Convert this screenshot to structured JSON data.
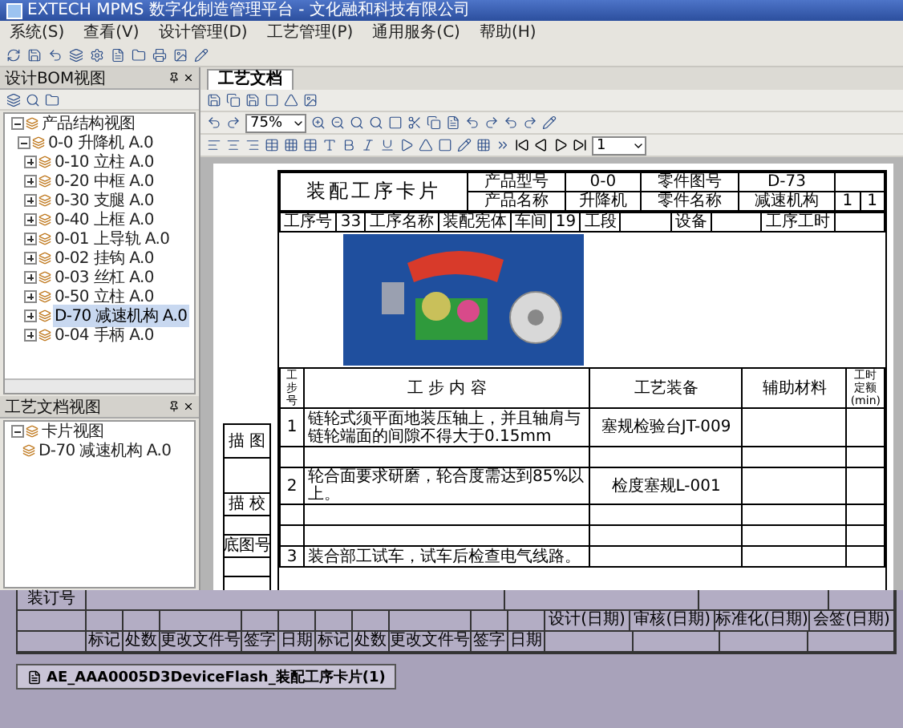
{
  "window": {
    "title": "EXTECH MPMS 数字化制造管理平台 - 文化融和科技有限公司"
  },
  "menu": [
    "系统(S)",
    "查看(V)",
    "设计管理(D)",
    "工艺管理(P)",
    "通用服务(C)",
    "帮助(H)"
  ],
  "bom_panel": {
    "title": "设计BOM视图",
    "tree": [
      {
        "label": "产品结构视图",
        "expanded": true,
        "selected": false,
        "children": [
          {
            "label": "0-0 升降机 A.0",
            "expanded": true,
            "selected": false,
            "children": [
              {
                "label": "0-10 立柱 A.0",
                "expanded": false,
                "selected": false
              },
              {
                "label": "0-20 中框 A.0",
                "expanded": false,
                "selected": false
              },
              {
                "label": "0-30 支腿 A.0",
                "expanded": false,
                "selected": false
              },
              {
                "label": "0-40 上框 A.0",
                "expanded": false,
                "selected": false
              },
              {
                "label": "0-01 上导轨 A.0",
                "expanded": false,
                "selected": false
              },
              {
                "label": "0-02 挂钩 A.0",
                "expanded": false,
                "selected": false
              },
              {
                "label": "0-03 丝杠 A.0",
                "expanded": false,
                "selected": false
              },
              {
                "label": "0-50 立柱 A.0",
                "expanded": false,
                "selected": false
              },
              {
                "label": "D-70 减速机构 A.0",
                "expanded": false,
                "selected": true
              },
              {
                "label": "0-04 手柄 A.0",
                "expanded": false,
                "selected": false
              }
            ]
          }
        ]
      }
    ]
  },
  "doc_panel": {
    "title": "工艺文档视图",
    "tree": [
      {
        "label": "卡片视图",
        "expanded": true,
        "selected": false,
        "children": [
          {
            "label": "D-70 减速机构 A.0",
            "selected": false
          }
        ]
      }
    ]
  },
  "tabs": [
    {
      "label": "工艺文档",
      "selected": true
    }
  ],
  "zoom": {
    "value": "75%"
  },
  "page": {
    "value": "1"
  },
  "card": {
    "title": "装配工序卡片",
    "header_rows": [
      [
        "产品型号",
        "0-0",
        "零件图号",
        "D-73"
      ],
      [
        "产品名称",
        "升降机",
        "零件名称",
        "减速机构",
        "1",
        "1"
      ]
    ],
    "process_row": [
      {
        "label": "工序号",
        "value": "33"
      },
      {
        "label": "工序名称",
        "value": "装配宪体"
      },
      {
        "label": "车间",
        "value": "19"
      },
      {
        "label": "工段"
      },
      {
        "label": "设备"
      },
      {
        "label": "工序工时"
      }
    ],
    "step_columns": [
      "工步号",
      "工 步 内 容",
      "工艺装备",
      "辅助材料",
      "工时定额(min)"
    ],
    "header_side": "描 图",
    "steps": [
      {
        "kind": "step",
        "no": "1",
        "content": "链轮式须平面地装压轴上，并且轴肩与链轮端面的间隙不得大于0.15mm",
        "equipment": "塞规检验台JT-009"
      },
      {
        "kind": "blank",
        "side": "描 校"
      },
      {
        "kind": "step",
        "no": "2",
        "content": "轮合面要求研磨，轮合度需达到85%以上。",
        "equipment": "检度塞规L-001"
      },
      {
        "kind": "blank",
        "side": "底图号"
      },
      {
        "kind": "blank"
      },
      {
        "kind": "step",
        "no": "3",
        "content": "装合部工试车，试车后检查电气线路。"
      }
    ],
    "binding_label": "装订号",
    "signoff": [
      "设计(日期)",
      "审核(日期)",
      "标准化(日期)",
      "会签(日期)"
    ],
    "revision_headers": [
      "标记",
      "处数",
      "更改文件号",
      "签字",
      "日期",
      "标记",
      "处数",
      "更改文件号",
      "签字",
      "日期"
    ]
  },
  "taskbar": [
    {
      "label": "AE_AAA0005D3DeviceFlash_装配工序卡片(1)",
      "selected": true
    }
  ]
}
